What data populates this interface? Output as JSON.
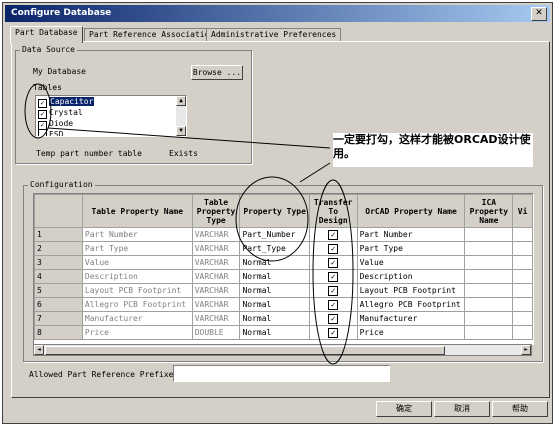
{
  "window": {
    "title": "Configure Database",
    "close_glyph": "✕"
  },
  "tabs": [
    {
      "label": "Part Database",
      "active": true
    },
    {
      "label": "Part Reference Associations",
      "active": false
    },
    {
      "label": "Administrative Preferences",
      "active": false
    }
  ],
  "data_source": {
    "legend": "Data Source",
    "db_label": "My Database",
    "browse_label": "Browse ...",
    "tables_label": "Tables",
    "tables": [
      {
        "name": "Capacitor",
        "checked": true,
        "selected": true
      },
      {
        "name": "Crystal",
        "checked": true,
        "selected": false
      },
      {
        "name": "Diode",
        "checked": true,
        "selected": false
      },
      {
        "name": "ESD",
        "checked": false,
        "selected": false
      }
    ],
    "temp_table_label": "Temp part number table",
    "exists_label": "Exists"
  },
  "annotation": {
    "text": "一定要打勾，这样才能被ORCAD设计使用。"
  },
  "configuration": {
    "legend": "Configuration",
    "columns": [
      "Table Property Name",
      "Table Property Type",
      "Property Type",
      "Transfer To Design",
      "OrCAD Property Name",
      "ICA Property Name",
      "Vi"
    ],
    "rows": [
      {
        "num": "1",
        "name": "Part Number",
        "type": "VARCHAR",
        "ptype": "Part_Number",
        "transfer": true,
        "orcad": "Part Number",
        "ica": "",
        "vi": ""
      },
      {
        "num": "2",
        "name": "Part Type",
        "type": "VARCHAR",
        "ptype": "Part_Type",
        "transfer": true,
        "orcad": "Part Type",
        "ica": "",
        "vi": ""
      },
      {
        "num": "3",
        "name": "Value",
        "type": "VARCHAR",
        "ptype": "Normal",
        "transfer": true,
        "orcad": "Value",
        "ica": "",
        "vi": ""
      },
      {
        "num": "4",
        "name": "Description",
        "type": "VARCHAR",
        "ptype": "Normal",
        "transfer": true,
        "orcad": "Description",
        "ica": "",
        "vi": ""
      },
      {
        "num": "5",
        "name": "Layout PCB Footprint",
        "type": "VARCHAR",
        "ptype": "Normal",
        "transfer": true,
        "orcad": "Layout PCB Footprint",
        "ica": "",
        "vi": ""
      },
      {
        "num": "6",
        "name": "Allegro PCB Footprint",
        "type": "VARCHAR",
        "ptype": "Normal",
        "transfer": true,
        "orcad": "Allegro PCB Footprint",
        "ica": "",
        "vi": ""
      },
      {
        "num": "7",
        "name": "Manufacturer",
        "type": "VARCHAR",
        "ptype": "Normal",
        "transfer": true,
        "orcad": "Manufacturer",
        "ica": "",
        "vi": ""
      },
      {
        "num": "8",
        "name": "Price",
        "type": "DOUBLE",
        "ptype": "Normal",
        "transfer": true,
        "orcad": "Price",
        "ica": "",
        "vi": ""
      }
    ],
    "check_glyph": "✓",
    "prefix_label": "Allowed Part Reference Prefixes :",
    "prefix_value": ""
  },
  "footer": {
    "ok": "确定",
    "cancel": "取消",
    "help": "帮助"
  },
  "colors": {
    "titlebar": "#0a246a",
    "face": "#d4d0c8",
    "selection": "#0a246a"
  }
}
